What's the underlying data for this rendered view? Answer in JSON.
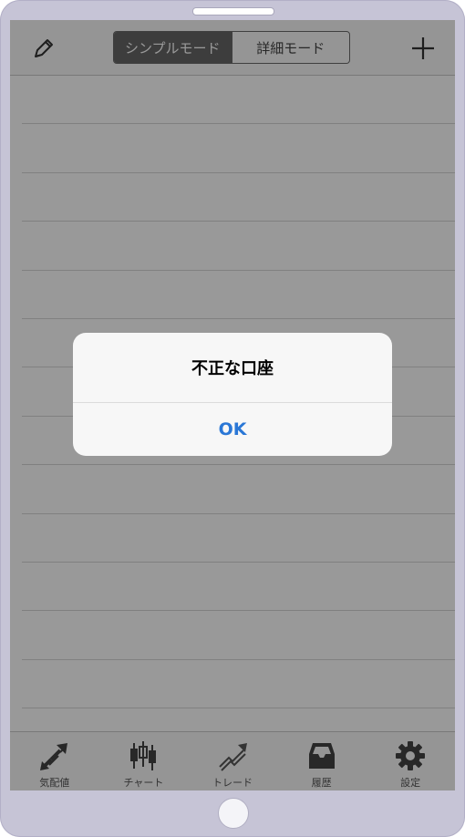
{
  "nav": {
    "segments": [
      {
        "label": "シンプルモード",
        "active": true
      },
      {
        "label": "詳細モード",
        "active": false
      }
    ],
    "left_icon": "pencil-icon",
    "right_icon": "plus-icon"
  },
  "tabs": [
    {
      "label": "気配値",
      "icon": "quotes-arrows-icon"
    },
    {
      "label": "チャート",
      "icon": "candlestick-icon"
    },
    {
      "label": "トレード",
      "icon": "trade-arrows-icon"
    },
    {
      "label": "履歴",
      "icon": "inbox-tray-icon"
    },
    {
      "label": "設定",
      "icon": "gear-icon"
    }
  ],
  "alert": {
    "title": "不正な口座",
    "button": "OK"
  },
  "colors": {
    "accent": "#2a77d6",
    "device_frame": "#c6c4d6"
  }
}
